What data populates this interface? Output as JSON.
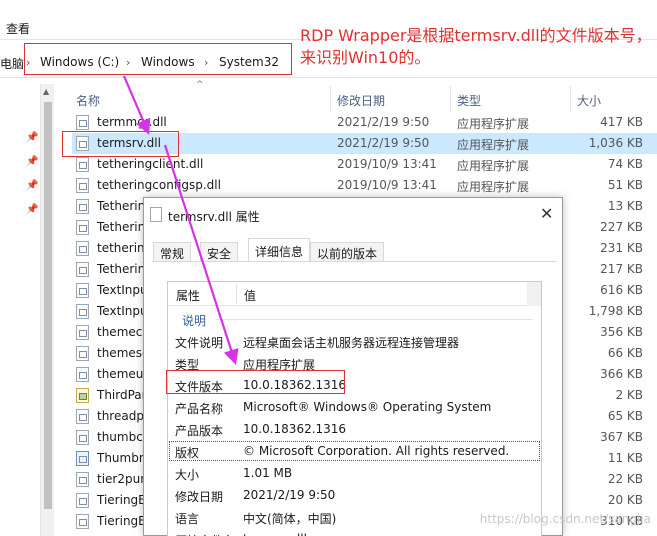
{
  "menu": {
    "view": "查看"
  },
  "address": {
    "left_cut": "电脑",
    "crumbs": [
      "Windows (C:)",
      "Windows",
      "System32"
    ]
  },
  "annotation": {
    "line1": "RDP Wrapper是根据termsrv.dll的文件版本号，",
    "line2": "来识别Win10的。"
  },
  "columns": {
    "name": "名称",
    "date": "修改日期",
    "type": "类型",
    "size": "大小"
  },
  "files": [
    {
      "name": "termmgr.dll",
      "date": "2021/2/19 9:50",
      "type": "应用程序扩展",
      "size": "417 KB",
      "icon": "dll-icon"
    },
    {
      "name": "termsrv.dll",
      "date": "2021/2/19 9:50",
      "type": "应用程序扩展",
      "size": "1,036 KB",
      "icon": "dll-icon"
    },
    {
      "name": "tetheringclient.dll",
      "date": "2019/10/9 13:41",
      "type": "应用程序扩展",
      "size": "74 KB",
      "icon": "dll-icon"
    },
    {
      "name": "tetheringconfigsp.dll",
      "date": "2019/10/9 13:41",
      "type": "应用程序扩展",
      "size": "51 KB",
      "icon": "dll-icon"
    },
    {
      "name": "Tetherin",
      "date": "",
      "type": "",
      "size": "13 KB",
      "icon": "dll-icon"
    },
    {
      "name": "Tetherin",
      "date": "",
      "type": "",
      "size": "227 KB",
      "icon": "dll-icon"
    },
    {
      "name": "tetherin",
      "date": "",
      "type": "",
      "size": "231 KB",
      "icon": "dll-icon"
    },
    {
      "name": "Tetherin",
      "date": "",
      "type": "",
      "size": "217 KB",
      "icon": "dll-icon"
    },
    {
      "name": "TextInpu",
      "date": "",
      "type": "",
      "size": "616 KB",
      "icon": "dll-icon"
    },
    {
      "name": "TextInpu",
      "date": "",
      "type": "",
      "size": "1,798 KB",
      "icon": "dll-icon"
    },
    {
      "name": "themecp",
      "date": "",
      "type": "",
      "size": "356 KB",
      "icon": "dll-icon"
    },
    {
      "name": "themese",
      "date": "",
      "type": "",
      "size": "66 KB",
      "icon": "dll-icon"
    },
    {
      "name": "themeui",
      "date": "",
      "type": "",
      "size": "366 KB",
      "icon": "dll-icon"
    },
    {
      "name": "ThirdPar",
      "date": "",
      "type": "",
      "size": "2 KB",
      "icon": "image-icon"
    },
    {
      "name": "threadp",
      "date": "",
      "type": "",
      "size": "65 KB",
      "icon": "dll-icon"
    },
    {
      "name": "thumbca",
      "date": "",
      "type": "",
      "size": "367 KB",
      "icon": "dll-icon"
    },
    {
      "name": "Thumbn",
      "date": "",
      "type": "",
      "size": "11 KB",
      "icon": "ruler-icon"
    },
    {
      "name": "tier2pun",
      "date": "",
      "type": "",
      "size": "22 KB",
      "icon": "dll-icon"
    },
    {
      "name": "TieringE",
      "date": "",
      "type": "",
      "size": "20 KB",
      "icon": "dll-icon"
    },
    {
      "name": "TieringE",
      "date": "",
      "type": "",
      "size": "310 KB",
      "icon": "dll-icon"
    }
  ],
  "dialog": {
    "title": "termsrv.dll 属性",
    "close": "✕",
    "tabs": [
      "常规",
      "安全",
      "详细信息",
      "以前的版本"
    ],
    "active_tab": "详细信息",
    "header": {
      "prop": "属性",
      "value": "值"
    },
    "category": "说明",
    "props": [
      {
        "k": "文件说明",
        "v": "远程桌面会话主机服务器远程连接管理器"
      },
      {
        "k": "类型",
        "v": "应用程序扩展"
      },
      {
        "k": "文件版本",
        "v": "10.0.18362.1316"
      },
      {
        "k": "产品名称",
        "v": "Microsoft® Windows® Operating System"
      },
      {
        "k": "产品版本",
        "v": "10.0.18362.1316"
      },
      {
        "k": "版权",
        "v": "© Microsoft Corporation. All rights reserved."
      },
      {
        "k": "大小",
        "v": "1.01 MB"
      },
      {
        "k": "修改日期",
        "v": "2021/2/19 9:50"
      },
      {
        "k": "语言",
        "v": "中文(简体，中国)"
      },
      {
        "k": "原始文件名",
        "v": "termsrv.dll"
      }
    ]
  },
  "watermark": "https://blog.csdn.net/sangjia",
  "colors": {
    "annotation": "#e03030",
    "arrow": "#d633e6",
    "selection": "#cce8ff"
  }
}
